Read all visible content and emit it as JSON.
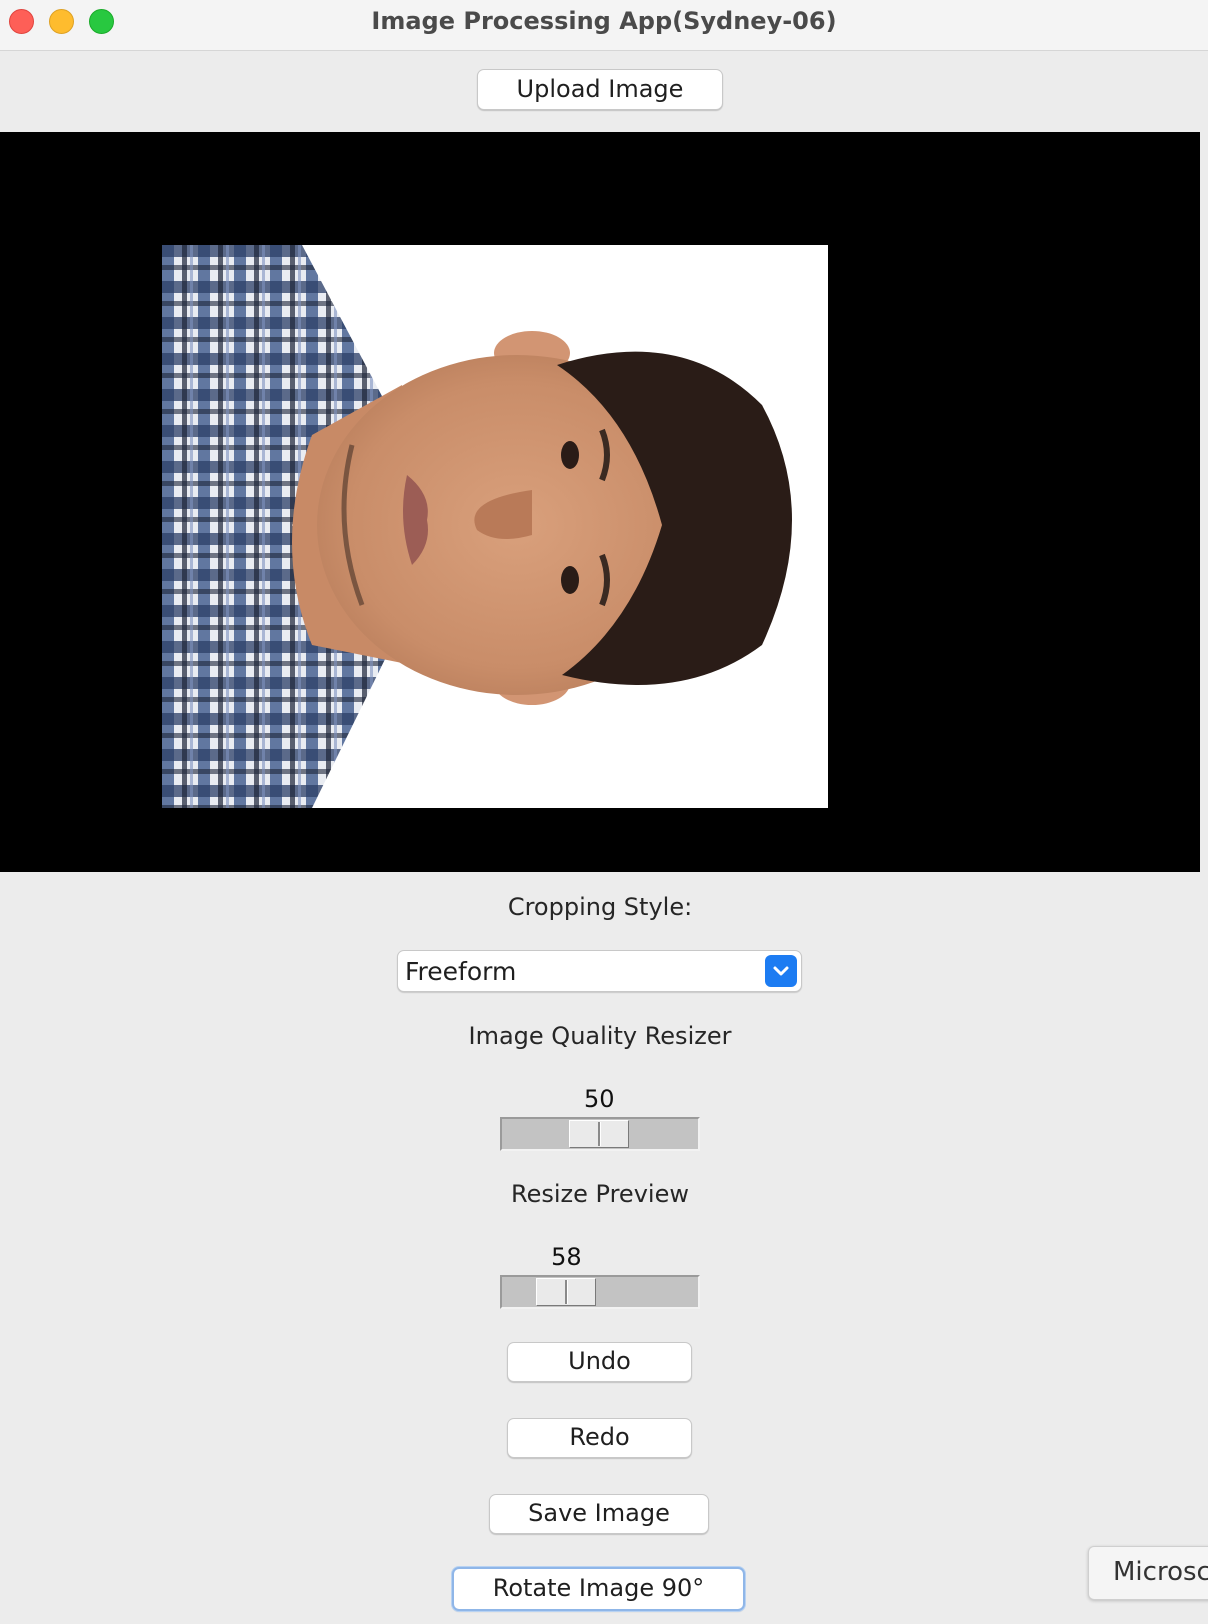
{
  "window": {
    "title": "Image Processing App(Sydney-06)"
  },
  "toolbar": {
    "upload_label": "Upload Image"
  },
  "canvas": {
    "image_description_icon": "portrait-photo"
  },
  "cropping": {
    "label": "Cropping Style:",
    "selected": "Freeform"
  },
  "quality": {
    "label": "Image Quality Resizer",
    "value": 50,
    "min": 1,
    "max": 100
  },
  "preview": {
    "label": "Resize Preview",
    "value": 58,
    "min": 10,
    "max": 200
  },
  "actions": {
    "undo_label": "Undo",
    "redo_label": "Redo",
    "save_label": "Save Image",
    "rotate_label": "Rotate Image 90°"
  },
  "background_window": {
    "label": "Microsc"
  },
  "colors": {
    "accent": "#1d7cf2",
    "canvas_bg": "#000000",
    "window_bg": "#ececec"
  }
}
